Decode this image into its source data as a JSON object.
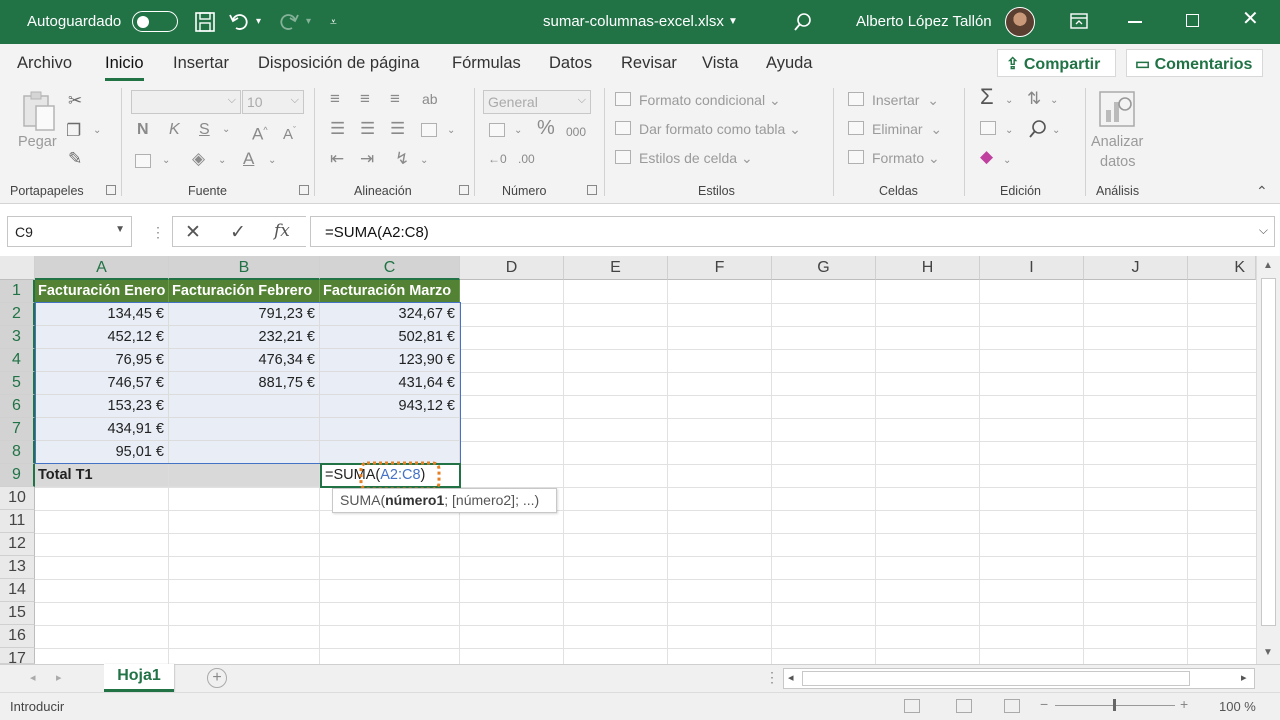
{
  "titlebar": {
    "autosave_label": "Autoguardado",
    "filename": "sumar-columnas-excel.xlsx",
    "user": "Alberto López Tallón"
  },
  "tabs": [
    "Archivo",
    "Inicio",
    "Insertar",
    "Disposición de página",
    "Fórmulas",
    "Datos",
    "Revisar",
    "Vista",
    "Ayuda"
  ],
  "active_tab": "Inicio",
  "share_label": "Compartir",
  "comments_label": "Comentarios",
  "ribbon": {
    "groups": {
      "clipboard": "Portapapeles",
      "font": "Fuente",
      "alignment": "Alineación",
      "number": "Número",
      "styles": "Estilos",
      "cells": "Celdas",
      "editing": "Edición",
      "analysis": "Análisis"
    },
    "paste": "Pegar",
    "font_size": "10",
    "bold": "N",
    "italic": "K",
    "underline": "S",
    "number_format": "General",
    "percent": "%",
    "thousands": "000",
    "conditional_format": "Formato condicional",
    "format_as_table": "Dar formato como tabla",
    "cell_styles": "Estilos de celda",
    "insert": "Insertar",
    "delete": "Eliminar",
    "format": "Formato",
    "analyze_line1": "Analizar",
    "analyze_line2": "datos"
  },
  "formula_bar": {
    "name_box": "C9",
    "formula": "=SUMA(A2:C8)",
    "fx": "fx"
  },
  "columns": [
    "A",
    "B",
    "C",
    "D",
    "E",
    "F",
    "G",
    "H",
    "I",
    "J",
    "K"
  ],
  "rows": [
    "1",
    "2",
    "3",
    "4",
    "5",
    "6",
    "7",
    "8",
    "9",
    "10",
    "11",
    "12",
    "13",
    "14",
    "15",
    "16",
    "17"
  ],
  "table": {
    "headers": [
      "Facturación Enero",
      "Facturación Febrero",
      "Facturación Marzo"
    ],
    "rows": [
      [
        "134,45 €",
        "791,23 €",
        "324,67 €"
      ],
      [
        "452,12 €",
        "232,21 €",
        "502,81 €"
      ],
      [
        "76,95 €",
        "476,34 €",
        "123,90 €"
      ],
      [
        "746,57 €",
        "881,75 €",
        "431,64 €"
      ],
      [
        "153,23 €",
        "",
        "943,12 €"
      ],
      [
        "434,91 €",
        "",
        ""
      ],
      [
        "95,01 €",
        "",
        ""
      ]
    ],
    "total_label": "Total T1",
    "editing_prefix": "=SUMA(",
    "editing_ref": "A2:C8",
    "editing_suffix": ")"
  },
  "tooltip": {
    "prefix": "SUMA(",
    "bold": "número1",
    "rest": "; [número2]; ...)"
  },
  "sheet_tab": "Hoja1",
  "status": {
    "mode": "Introducir",
    "zoom": "100 %"
  },
  "colors": {
    "excel_green": "#217346",
    "header_fill": "#548235",
    "range_blue": "#4472c4",
    "range_fill": "#e8edf6"
  }
}
